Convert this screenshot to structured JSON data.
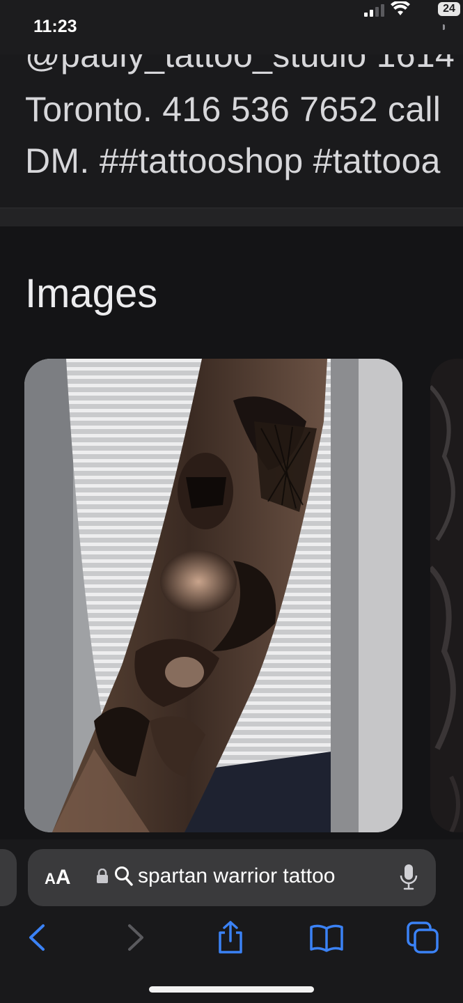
{
  "status_bar": {
    "time": "11:23",
    "battery": "24",
    "icons": [
      "signal-icon",
      "wifi-icon",
      "battery-icon"
    ]
  },
  "snippet": {
    "lines": [
      "@pauly_tattoo_studio 1614",
      "Toronto. 416 536 7652 call",
      "DM. ##tattooshop #tattooa"
    ]
  },
  "images_section": {
    "heading": "Images",
    "items": [
      {
        "subject": "spartan-warrior-forearm-tattoo"
      },
      {
        "subject": "tattoo-image-partial"
      }
    ]
  },
  "address_bar": {
    "aa_label_big": "A",
    "aa_label_small": "A",
    "url_text": "spartan warrior tattoo",
    "icons": [
      "lock-icon",
      "search-icon",
      "mic-icon"
    ]
  },
  "toolbar": {
    "buttons": [
      "back",
      "forward",
      "share",
      "bookmarks",
      "tabs"
    ],
    "accent_color": "#3b82f6",
    "disabled_color": "#5a5a5e"
  }
}
